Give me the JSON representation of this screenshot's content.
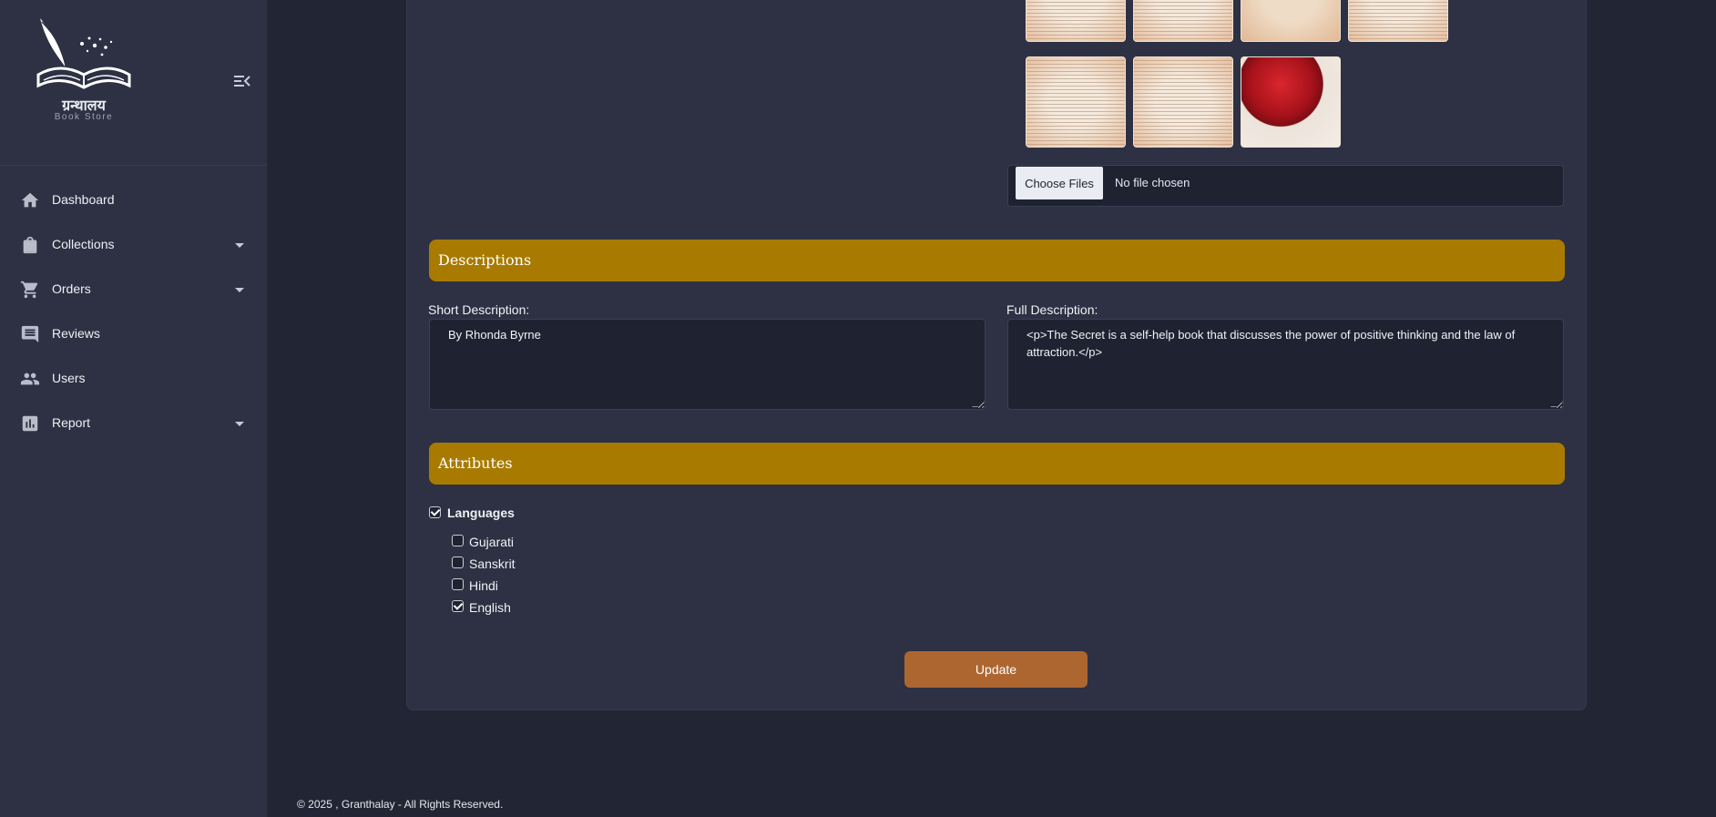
{
  "brand": {
    "name_devanagari": "ग्रन्थालय",
    "tagline": "Book Store",
    "logo_icon": "book-quill-logo",
    "collapse_icon": "menu-collapse-icon"
  },
  "sidebar": {
    "items": [
      {
        "label": "Dashboard",
        "icon": "home-icon",
        "has_submenu": false
      },
      {
        "label": "Collections",
        "icon": "shopping-bag-icon",
        "has_submenu": true
      },
      {
        "label": "Orders",
        "icon": "cart-icon",
        "has_submenu": true
      },
      {
        "label": "Reviews",
        "icon": "comment-icon",
        "has_submenu": false
      },
      {
        "label": "Users",
        "icon": "users-icon",
        "has_submenu": false
      },
      {
        "label": "Report",
        "icon": "bar-chart-icon",
        "has_submenu": true
      }
    ]
  },
  "images": {
    "file_input": {
      "button_label": "Choose Files",
      "status": "No file chosen"
    }
  },
  "descriptions": {
    "section_title": "Descriptions",
    "short_label": "Short Description:",
    "short_value": "By Rhonda Byrne",
    "full_label": "Full Description:",
    "full_value": "<p>The Secret is a self-help book that discusses the power of positive thinking and the law of attraction.</p>"
  },
  "attributes": {
    "section_title": "Attributes",
    "group_label": "Languages",
    "group_checked": true,
    "options": [
      {
        "label": "Gujarati",
        "checked": false
      },
      {
        "label": "Sanskrit",
        "checked": false
      },
      {
        "label": "Hindi",
        "checked": false
      },
      {
        "label": "English",
        "checked": true
      }
    ]
  },
  "actions": {
    "update_label": "Update"
  },
  "footer": {
    "text": "© 2025 , Granthalay - All Rights Reserved."
  },
  "colors": {
    "background": "#222533",
    "panel": "#2d3143",
    "section_header": "#a87b00",
    "update_button": "#ad6630"
  }
}
